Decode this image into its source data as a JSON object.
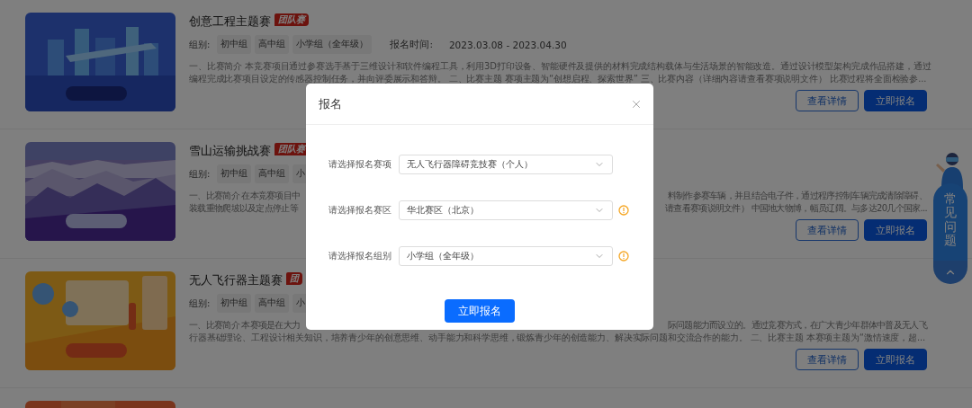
{
  "competitions": [
    {
      "picture": {
        "kind": "picture"
      },
      "title": "创意工程主题赛",
      "badge": "团队赛",
      "groups_label": "组别:",
      "groups": [
        "初中组",
        "高中组",
        "小学组（全年级）"
      ],
      "time_label": "报名时间:",
      "time": "2023.03.08 - 2023.04.30",
      "description": [
        [
          "一、比赛简介 本竞赛项目通过参赛选手基于三维设计和软件编程工具，利用3D打印设备、智能硬件及提供的材料完成结构载体与生活场景的智能改造。通过设计模型架构完成作品搭建，通过"
        ],
        [
          "编程完成比赛项目设定的传感器控制任务，并向评委展示和答辩。 二、比赛主题 赛项主题为“创想启程、探索世界” 三、比赛内容（详细内容请查看赛项说明文件） 比赛过程将全面检验参..."
        ]
      ],
      "buttons": [
        "查看详情",
        "立即报名"
      ]
    },
    {
      "picture": {
        "kind": "picture"
      },
      "title": "雪山运输挑战赛",
      "badge": "团队赛",
      "groups_label": "组别:",
      "groups": [
        "初中组",
        "高中组",
        "小"
      ],
      "description": [
        [
          "一、比赛简介 在本竞赛项目中",
          "料制作参赛车辆，并且结合电子件，通过程序控制车辆完成清除障碍、"
        ],
        [
          "装载重物爬坡以及定点停止等",
          "请查看赛项说明文件） 中国地大物博，幅员辽阔。与多达20几个国家..."
        ]
      ],
      "buttons": [
        "查看详情",
        "立即报名"
      ]
    },
    {
      "picture": {
        "kind": "picture"
      },
      "title": "无人飞行器主题赛",
      "badge": "团",
      "groups_label": "组别:",
      "groups": [
        "初中组",
        "高中组",
        "小"
      ],
      "description": [
        [
          "一、比赛简介 本赛项是在大力",
          "际问题能力而设立的。通过竞赛方式，在广大青少年群体中普及无人飞"
        ],
        [
          "行器基础理论、工程设计相关知识，培养青少年的创意思维、动手能力和科学思维，锻炼青少年的创造能力、解决实际问题和交流合作的能力。 二、比赛主题 本赛项主题为“激情速度，超..."
        ]
      ],
      "buttons": [
        "查看详情",
        "立即报名"
      ]
    },
    {
      "picture": {
        "kind": "picture"
      }
    }
  ],
  "faq": {
    "label": "常见问题"
  },
  "dialog": {
    "title": "报名",
    "fields": [
      {
        "label": "请选择报名赛项",
        "value": "无人飞行器障碍竞技赛（个人）",
        "info": false
      },
      {
        "label": "请选择报名赛区",
        "value": "华北赛区（北京）",
        "info": true
      },
      {
        "label": "请选择报名组别",
        "value": "小学组（全年级）",
        "info": true
      }
    ],
    "submit": "立即报名"
  }
}
